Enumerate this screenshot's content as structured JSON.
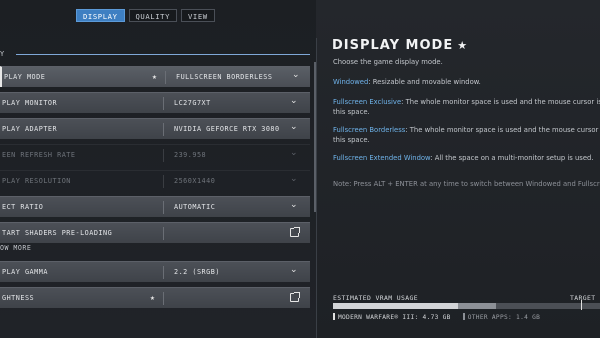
{
  "tabs": [
    "DISPLAY",
    "QUALITY",
    "VIEW"
  ],
  "section": {
    "label": "Y"
  },
  "rows": [
    {
      "label": "PLAY MODE",
      "star": "★",
      "value": "FULLSCREEN BORDERLESS",
      "control": "dropdown",
      "state": "selected"
    },
    {
      "label": "PLAY MONITOR",
      "value": "LC27G7XT",
      "control": "dropdown",
      "state": "normal"
    },
    {
      "label": "PLAY ADAPTER",
      "value": "NVIDIA GEFORCE RTX 3080",
      "control": "dropdown",
      "state": "normal"
    },
    {
      "label": "EEN REFRESH RATE",
      "value": "239.958",
      "control": "dropdown",
      "state": "disabled"
    },
    {
      "label": "PLAY RESOLUTION",
      "value": "2560X1440",
      "control": "dropdown",
      "state": "disabled"
    },
    {
      "label": "ECT RATIO",
      "value": "AUTOMATIC",
      "control": "dropdown",
      "state": "normal"
    },
    {
      "label": "TART SHADERS PRE-LOADING",
      "value": "",
      "control": "external",
      "state": "normal"
    },
    {
      "label": "PLAY GAMMA",
      "value": "2.2 (SRGB)",
      "control": "dropdown",
      "state": "normal"
    },
    {
      "label": "GHTNESS",
      "star": "★",
      "value": "",
      "control": "external",
      "state": "normal"
    }
  ],
  "show_more": "OW MORE",
  "detail": {
    "title": "DISPLAY MODE",
    "star": "★",
    "subtitle": "Choose the game display mode.",
    "options": [
      {
        "name": "Windowed",
        "desc": ": Resizable and movable window."
      },
      {
        "name": "Fullscreen Exclusive",
        "desc": ": The whole monitor space is used and the mouse cursor is",
        "desc2": "this space."
      },
      {
        "name": "Fullscreen Borderless",
        "desc": ": The whole monitor space is used and the mouse cursor i",
        "desc2": "this space."
      },
      {
        "name": "Fullscreen Extended Window",
        "desc": ": All the space on a multi-monitor setup is used."
      }
    ],
    "note": "Note: Press ALT + ENTER at any time to switch between Windowed and Fullscree"
  },
  "vram": {
    "label": "ESTIMATED VRAM USAGE",
    "target_label": "TARGET",
    "game_label": "MODERN WARFARE® III: 4.73 GB",
    "other_label": "OTHER APPS: 1.4 GB",
    "game_fraction": 0.47,
    "other_fraction": 0.14,
    "target_fraction": 0.93
  },
  "colors": {
    "accent": "#3e7fc2",
    "link": "#6fb3ea",
    "background": "#1f2226"
  }
}
